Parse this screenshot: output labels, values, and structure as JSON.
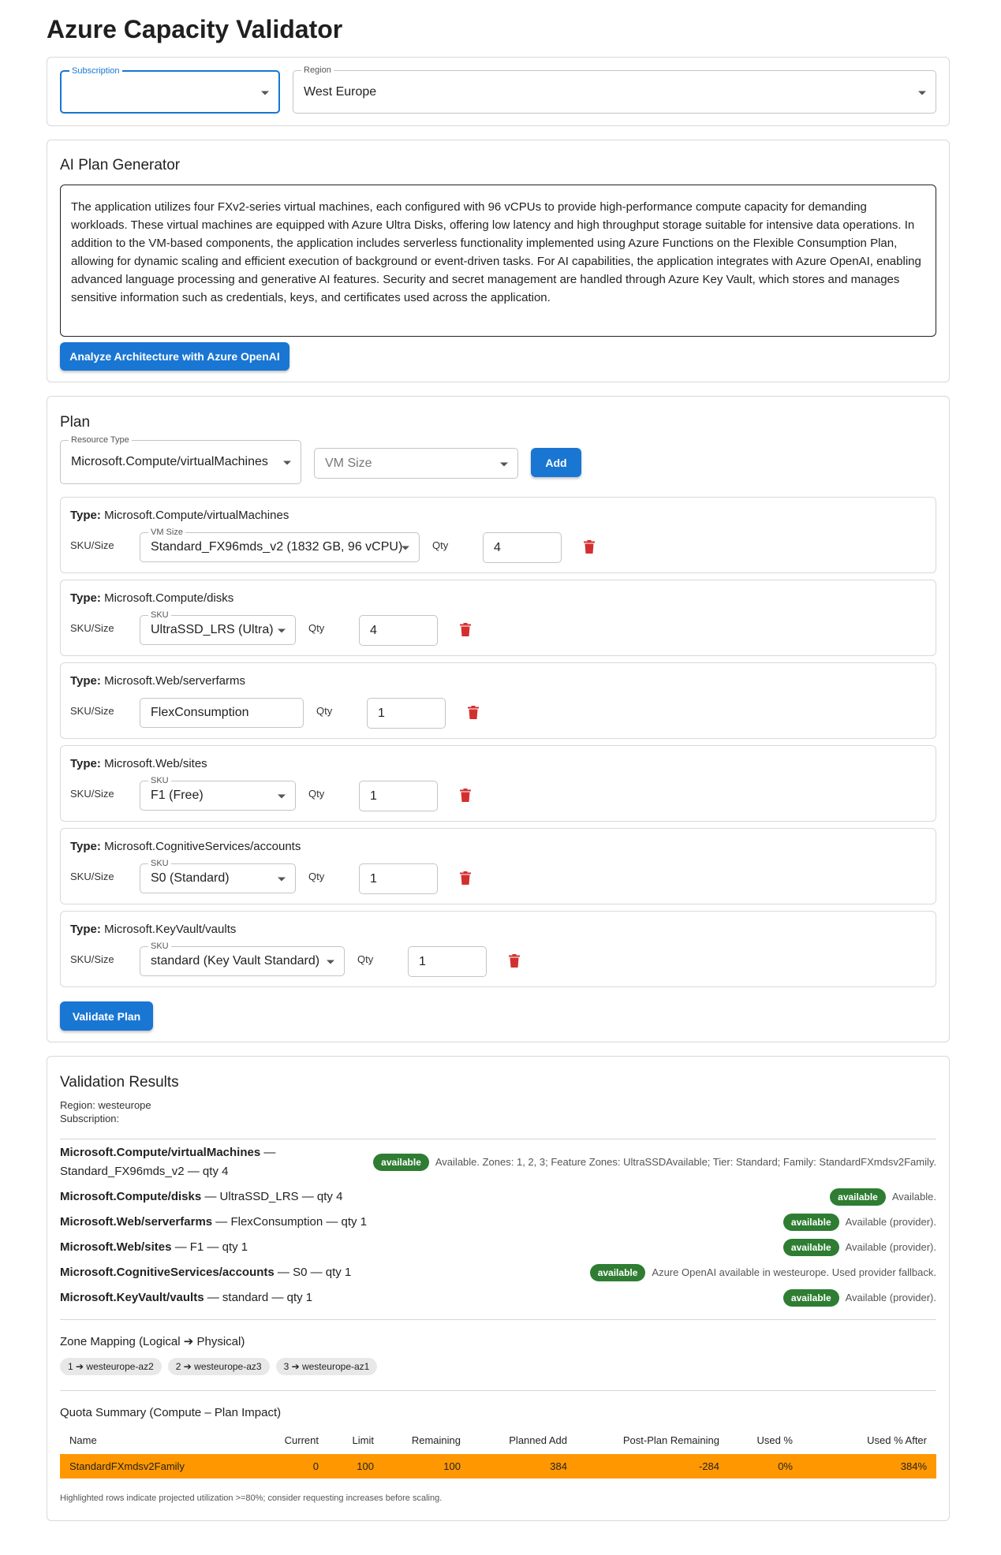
{
  "title": "Azure Capacity Validator",
  "selectors": {
    "subscription_label": "Subscription",
    "subscription_value": "",
    "region_label": "Region",
    "region_value": "West Europe"
  },
  "ai": {
    "title": "AI Plan Generator",
    "description": "The application utilizes four FXv2-series virtual machines, each configured with 96 vCPUs to provide high-performance compute capacity for demanding workloads. These virtual machines are equipped with Azure Ultra Disks, offering low latency and high throughput storage suitable for intensive data operations. In addition to the VM-based components, the application includes serverless functionality implemented using Azure Functions on the Flexible Consumption Plan, allowing for dynamic scaling and efficient execution of background or event-driven tasks. For AI capabilities, the application integrates with Azure OpenAI, enabling advanced language processing and generative AI features. Security and secret management are handled through Azure Key Vault, which stores and manages sensitive information such as credentials, keys, and certificates used across the application.",
    "analyze_button": "Analyze Architecture with Azure OpenAI"
  },
  "plan": {
    "title": "Plan",
    "resource_type_label": "Resource Type",
    "resource_type_value": "Microsoft.Compute/virtualMachines",
    "vm_size_placeholder": "VM Size",
    "add_button": "Add",
    "type_prefix": "Type:",
    "sku_size_label": "SKU/Size",
    "qty_label": "Qty",
    "items": [
      {
        "type": "Microsoft.Compute/virtualMachines",
        "field_label": "VM Size",
        "sku": "Standard_FX96mds_v2 (1832 GB, 96 vCPU)",
        "qty": "4"
      },
      {
        "type": "Microsoft.Compute/disks",
        "field_label": "SKU",
        "sku": "UltraSSD_LRS (Ultra)",
        "qty": "4"
      },
      {
        "type": "Microsoft.Web/serverfarms",
        "field_label": "",
        "sku": "FlexConsumption",
        "qty": "1"
      },
      {
        "type": "Microsoft.Web/sites",
        "field_label": "SKU",
        "sku": "F1 (Free)",
        "qty": "1"
      },
      {
        "type": "Microsoft.CognitiveServices/accounts",
        "field_label": "SKU",
        "sku": "S0 (Standard)",
        "qty": "1"
      },
      {
        "type": "Microsoft.KeyVault/vaults",
        "field_label": "SKU",
        "sku": "standard (Key Vault Standard)",
        "qty": "1"
      }
    ],
    "validate_button": "Validate Plan"
  },
  "results": {
    "title": "Validation Results",
    "region_line": "Region: westeurope",
    "subscription_line": "Subscription:",
    "rows": [
      {
        "resource": "Microsoft.Compute/virtualMachines",
        "detail_line1": " —",
        "detail_line2": "Standard_FX96mds_v2 — qty 4",
        "status": "available",
        "note": "Available. Zones: 1, 2, 3; Feature Zones: UltraSSDAvailable; Tier: Standard; Family: StandardFXmdsv2Family."
      },
      {
        "resource": "Microsoft.Compute/disks",
        "detail": " — UltraSSD_LRS — qty 4",
        "status": "available",
        "note": "Available."
      },
      {
        "resource": "Microsoft.Web/serverfarms",
        "detail": " — FlexConsumption — qty 1",
        "status": "available",
        "note": "Available (provider)."
      },
      {
        "resource": "Microsoft.Web/sites",
        "detail": " — F1 — qty 1",
        "status": "available",
        "note": "Available (provider)."
      },
      {
        "resource": "Microsoft.CognitiveServices/accounts",
        "detail": " — S0 — qty 1",
        "status": "available",
        "note": "Azure OpenAI available in westeurope. Used provider fallback."
      },
      {
        "resource": "Microsoft.KeyVault/vaults",
        "detail": " — standard — qty 1",
        "status": "available",
        "note": "Available (provider)."
      }
    ],
    "zone_title": "Zone Mapping (Logical ➔ Physical)",
    "zones": [
      "1 ➔ westeurope-az2",
      "2 ➔ westeurope-az3",
      "3 ➔ westeurope-az1"
    ],
    "quota_title": "Quota Summary (Compute – Plan Impact)",
    "quota_headers": [
      "Name",
      "Current",
      "Limit",
      "Remaining",
      "Planned Add",
      "Post-Plan Remaining",
      "Used %",
      "Used % After"
    ],
    "quota_rows": [
      [
        "StandardFXmdsv2Family",
        "0",
        "100",
        "100",
        "384",
        "-284",
        "0%",
        "384%"
      ]
    ],
    "quota_note": "Highlighted rows indicate projected utilization >=80%; consider requesting increases before scaling."
  },
  "colors": {
    "primary": "#1976d2",
    "success": "#2e7d32",
    "warning_row": "#ff9800",
    "delete": "#d32f2f"
  }
}
